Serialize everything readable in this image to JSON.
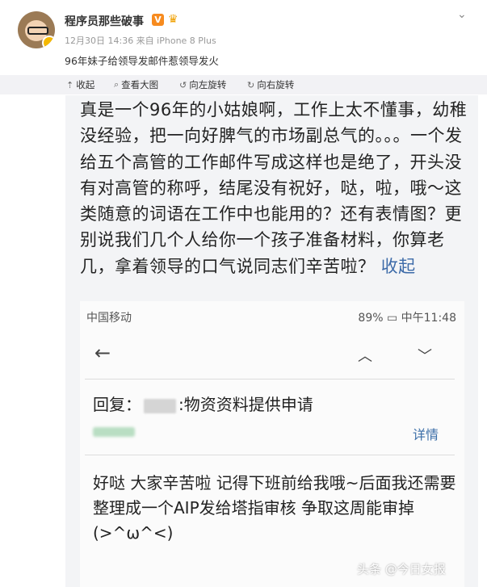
{
  "post": {
    "username": "程序员那些破事",
    "verified_badge": "V",
    "meta": "12月30日 14:36 来自 iPhone 8 Plus",
    "caption": "96年妹子给领导发邮件惹领导发火",
    "menu_icon": "chevron-down-icon"
  },
  "toolbar": {
    "collapse": "收起",
    "view_large": "查看大图",
    "rotate_left": "向左旋转",
    "rotate_right": "向右旋转"
  },
  "image": {
    "comment_text": "真是一个96年的小姑娘啊，工作上太不懂事，幼稚没经验，把一向好脾气的市场副总气的。。。一个发给五个高管的工作邮件写成这样也是绝了，开头没有对高管的称呼，结尾没有祝好，哒，啦，哦～这类随意的词语在工作中也能用的？还有表情图？更别说我们几个人给你一个孩子准备材料，你算老几，拿着领导的口气说同志们辛苦啦？",
    "comment_collapse": "收起",
    "carrier": "中国移动",
    "status_right": "89%  ▭  中午11:48",
    "subject_prefix": "回复：",
    "subject_suffix": ":物资资料提供申请",
    "details": "详情",
    "email_body": "好哒 大家辛苦啦 记得下班前给我哦~后面我还需要整理成一个AIP发给塔指审核 争取这周能审掉(>^ω^<)"
  },
  "watermark": "头条 @今日女报"
}
